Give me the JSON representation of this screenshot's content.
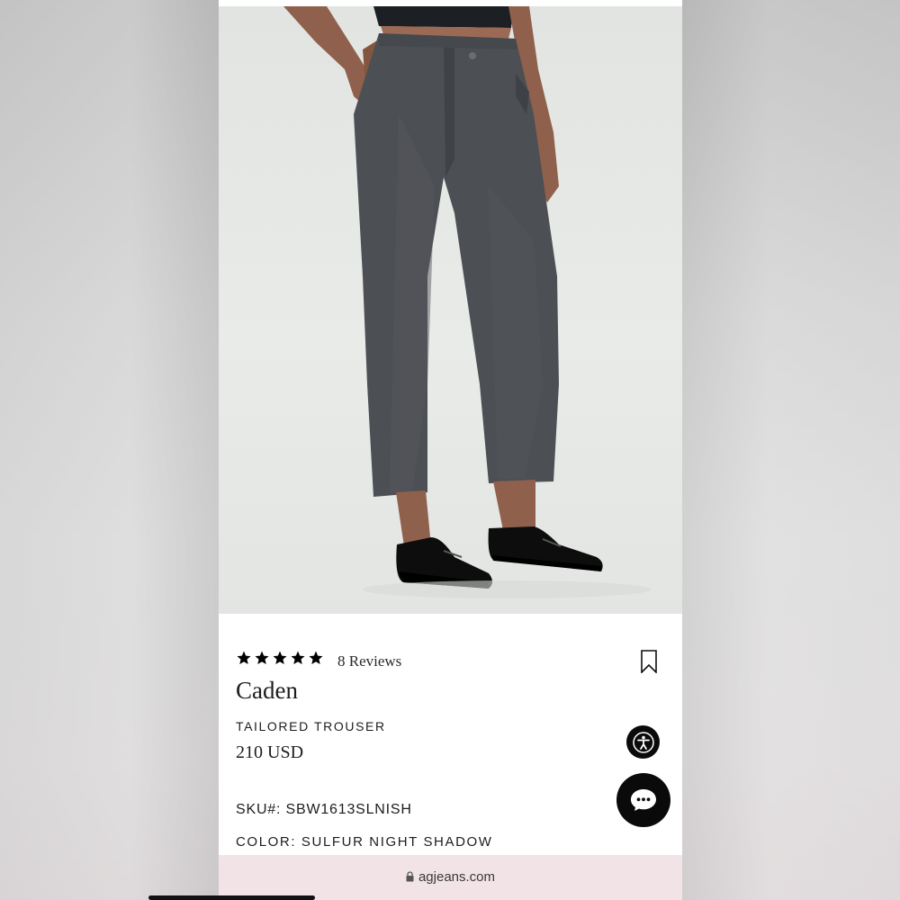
{
  "product": {
    "rating": 5,
    "reviews_label": "8 Reviews",
    "name": "Caden",
    "type": "TAILORED TROUSER",
    "price": "210 USD",
    "sku_label": "SKU#:",
    "sku_value": "SBW1613SLNISH",
    "color_label": "COLOR:",
    "color_value": "SULFUR NIGHT SHADOW"
  },
  "icons": {
    "star": "star-icon",
    "bookmark": "bookmark-icon",
    "accessibility": "accessibility-icon",
    "chat": "chat-icon",
    "lock": "lock-icon"
  },
  "browser": {
    "url": "agjeans.com"
  },
  "colors": {
    "accent": "#0a0a0a",
    "url_bar": "#f2e3e6"
  }
}
